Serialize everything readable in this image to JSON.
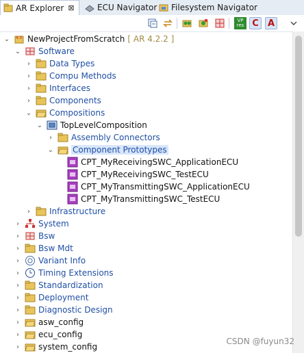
{
  "tabs": [
    {
      "label": "AR Explorer",
      "close": "⊠"
    },
    {
      "label": "ECU Navigator"
    },
    {
      "label": "Filesystem Navigator"
    }
  ],
  "toolbar": {
    "icons": [
      "collapse-all",
      "link-with-editor",
      "new-element-1",
      "new-element-2",
      "grid",
      "vp-res",
      "c-filter",
      "a-filter",
      "view-menu"
    ],
    "vp_res_top": "VP",
    "vp_res_bottom": "res",
    "c_letter": "C",
    "a_letter": "A"
  },
  "tree": {
    "project": "NewProjectFromScratch",
    "project_version": "[ AR 4.2.2 ]",
    "software": "Software",
    "software_children": [
      "Data Types",
      "Compu Methods",
      "Interfaces",
      "Components",
      "Compositions"
    ],
    "top_level": "TopLevelComposition",
    "assembly": "Assembly Connectors",
    "prototypes": "Component Prototypes",
    "prototype_items": [
      "CPT_MyReceivingSWC_ApplicationECU",
      "CPT_MyReceivingSWC_TestECU",
      "CPT_MyTransmittingSWC_ApplicationECU",
      "CPT_MyTransmittingSWC_TestECU"
    ],
    "infrastructure": "Infrastructure",
    "top_items": [
      "System",
      "Bsw",
      "Bsw Mdt",
      "Variant Info",
      "Timing Extensions",
      "Standardization",
      "Deployment",
      "Diagnostic Design"
    ],
    "folders": [
      "asw_config",
      "ecu_config",
      "system_config"
    ]
  },
  "colors": {
    "accent": "#1f4fa5",
    "folder": "#e8c45a",
    "selection": "#d8e6fa"
  },
  "watermark": "CSDN @fuyun32"
}
